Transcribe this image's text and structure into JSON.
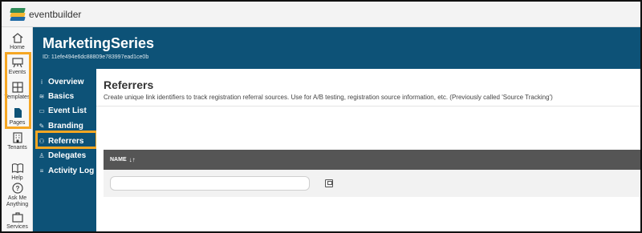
{
  "app": {
    "brand": "eventbuilder"
  },
  "rail": {
    "items": [
      {
        "label": "Home",
        "icon": "home-icon"
      },
      {
        "label": "Events",
        "icon": "easel-icon"
      },
      {
        "label": "Templates",
        "icon": "grid-icon"
      },
      {
        "label": "Pages",
        "icon": "page-icon"
      },
      {
        "label": "Tenants",
        "icon": "building-icon"
      },
      {
        "label": "Help",
        "icon": "book-icon"
      },
      {
        "label": "Ask Me Anything",
        "icon": "question-icon"
      },
      {
        "label": "Services",
        "icon": "briefcase-icon"
      }
    ]
  },
  "header": {
    "title": "MarketingSeries",
    "id_text": "ID: 11efe494e6dc88809e783997ead1ce0b"
  },
  "subnav": {
    "items": [
      {
        "label": "Overview",
        "icon": "info-icon"
      },
      {
        "label": "Basics",
        "icon": "antenna-icon"
      },
      {
        "label": "Event List",
        "icon": "monitor-icon"
      },
      {
        "label": "Branding",
        "icon": "pencil-icon"
      },
      {
        "label": "Referrers",
        "icon": "people-icon",
        "active": true
      },
      {
        "label": "Delegates",
        "icon": "person-icon"
      },
      {
        "label": "Activity Log",
        "icon": "list-icon"
      }
    ]
  },
  "content": {
    "title": "Referrers",
    "description": "Create unique link identifiers to track registration referral sources. Use for A/B testing, registration source information, etc. (Previously called 'Source Tracking')",
    "table": {
      "column": "NAME",
      "sort_icon": "sort-icon",
      "input_value": ""
    }
  },
  "colors": {
    "primary": "#0d5277",
    "highlight": "#f5a623",
    "table_header": "#555555"
  }
}
